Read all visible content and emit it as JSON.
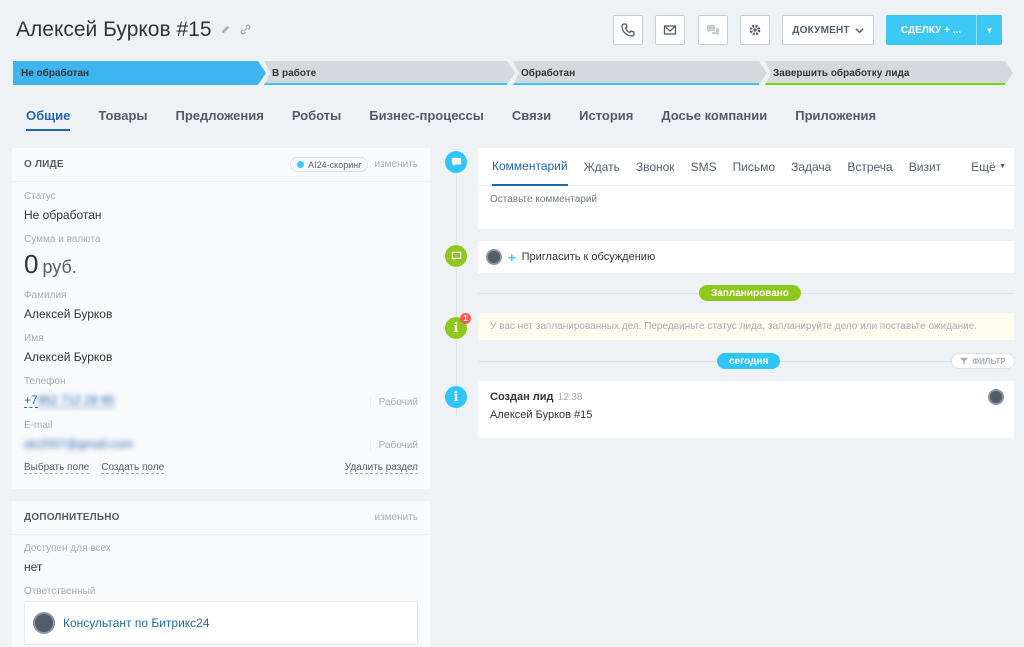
{
  "header": {
    "title": "Алексей Бурков #15",
    "document_label": "ДОКУМЕНТ",
    "deal_label": "СДЕЛКУ + ..."
  },
  "stages": [
    {
      "label": "Не обработан",
      "color": "#3fb5f0",
      "text": "#333",
      "bar": "#3fb5f0"
    },
    {
      "label": "В работе",
      "color": "#d5d8dc",
      "text": "#333",
      "bar": "#3bc8f5"
    },
    {
      "label": "Обработан",
      "color": "#d5d8dc",
      "text": "#333",
      "bar": "#3bc8f5"
    },
    {
      "label": "Завершить обработку лида",
      "color": "#d5d8dc",
      "text": "#333",
      "bar": "#7bd500"
    }
  ],
  "tabs": [
    "Общие",
    "Товары",
    "Предложения",
    "Роботы",
    "Бизнес-процессы",
    "Связи",
    "История",
    "Досье компании",
    "Приложения"
  ],
  "about": {
    "heading": "О ЛИДЕ",
    "scoring_label": "AI24-скоринг",
    "edit_label": "изменить",
    "status_label": "Статус",
    "status_value": "Не обработан",
    "amount_label": "Сумма и валюта",
    "amount_value": "0",
    "currency": "руб.",
    "surname_label": "Фамилия",
    "surname_value": "Алексей Бурков",
    "name_label": "Имя",
    "name_value": "Алексей Бурков",
    "phone_label": "Телефон",
    "phone_prefix": "+7",
    "phone_value": " 952 712 28 65",
    "phone_type": "Рабочий",
    "email_label": "E-mail",
    "email_value": "alc2007@gmail.com",
    "email_type": "Рабочий",
    "select_field": "Выбрать поле",
    "create_field": "Создать поле",
    "delete_section": "Удалить раздел"
  },
  "additional": {
    "heading": "ДОПОЛНИТЕЛЬНО",
    "edit_label": "изменить",
    "available_label": "Доступен для всех",
    "available_value": "нет",
    "responsible_label": "Ответственный",
    "responsible_value": "Консультант по Битрикс24"
  },
  "composer": {
    "tabs": [
      "Комментарий",
      "Ждать",
      "Звонок",
      "SMS",
      "Письмо",
      "Задача",
      "Встреча",
      "Визит"
    ],
    "more": "Ещё",
    "placeholder": "Оставьте комментарий"
  },
  "invite_label": "Пригласить к обсуждению",
  "planned_label": "Запланировано",
  "notice_text": "У вас нет запланированных дел. Передвиньте статус лида, запланируйте дело или поставьте ожидание.",
  "notice_count": "1",
  "today_label": "сегодня",
  "filter_label": "ФИЛЬТР",
  "entry": {
    "title": "Создан лид",
    "time": "12:38",
    "desc": "Алексей Бурков #15"
  }
}
